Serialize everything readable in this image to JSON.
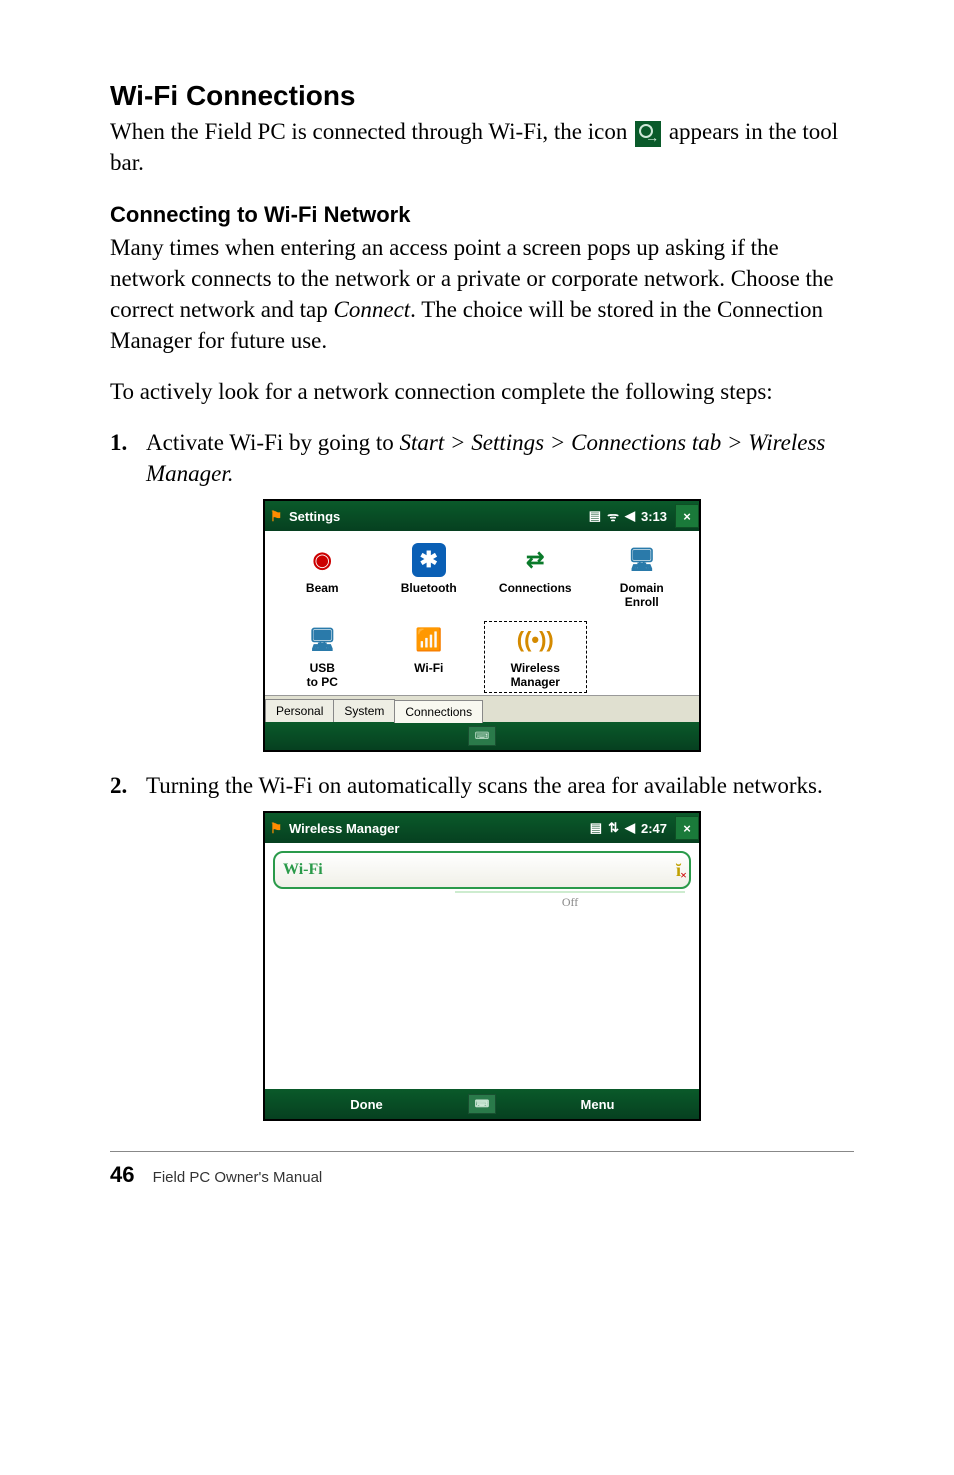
{
  "section_title": "Wi-Fi Connections",
  "intro_part1": "When the Field PC is connected through Wi-Fi, the icon ",
  "intro_part2": " appears in the tool bar.",
  "subheading": "Connecting to Wi-Fi Network",
  "para1_a": "Many times when entering an access point a screen pops up asking if the network connects to the network or a private or corporate network. Choose the correct network and tap ",
  "para1_connect": "Connect",
  "para1_b": ". The choice will be stored in the Connection Manager for future use.",
  "para2": "To actively look for a network connection complete the following steps:",
  "steps": [
    {
      "num": "1.",
      "a": "Activate Wi-Fi by going to ",
      "path": "Start > Settings > Connections tab > Wireless Manager.",
      "b": ""
    },
    {
      "num": "2.",
      "a": "Turning the Wi-Fi on automatically scans the area for available networks.",
      "path": "",
      "b": ""
    }
  ],
  "ss1": {
    "title": "Settings",
    "time": "3:13",
    "close": "×",
    "icons": [
      {
        "label": "Beam",
        "glyph": "◉",
        "cls": "ic-beam"
      },
      {
        "label": "Bluetooth",
        "glyph": "✱",
        "cls": "ic-bt"
      },
      {
        "label": "Connections",
        "glyph": "⇄",
        "cls": "ic-conn"
      },
      {
        "label": "Domain Enroll",
        "glyph": "🖥",
        "cls": "ic-domain"
      },
      {
        "label": "USB to PC",
        "glyph": "🖥",
        "cls": "ic-usb"
      },
      {
        "label": "Wi-Fi",
        "glyph": "📶",
        "cls": "ic-wifi"
      },
      {
        "label": "Wireless Manager",
        "glyph": "((•))",
        "cls": "ic-wm",
        "selected": true
      }
    ],
    "tabs": [
      "Personal",
      "System",
      "Connections"
    ],
    "active_tab": 2
  },
  "ss2": {
    "title": "Wireless Manager",
    "time": "2:47",
    "close": "×",
    "row_label": "Wi-Fi",
    "row_status": "Off",
    "left_btn": "Done",
    "right_btn": "Menu"
  },
  "footer": {
    "page": "46",
    "book": "Field PC Owner's Manual"
  }
}
